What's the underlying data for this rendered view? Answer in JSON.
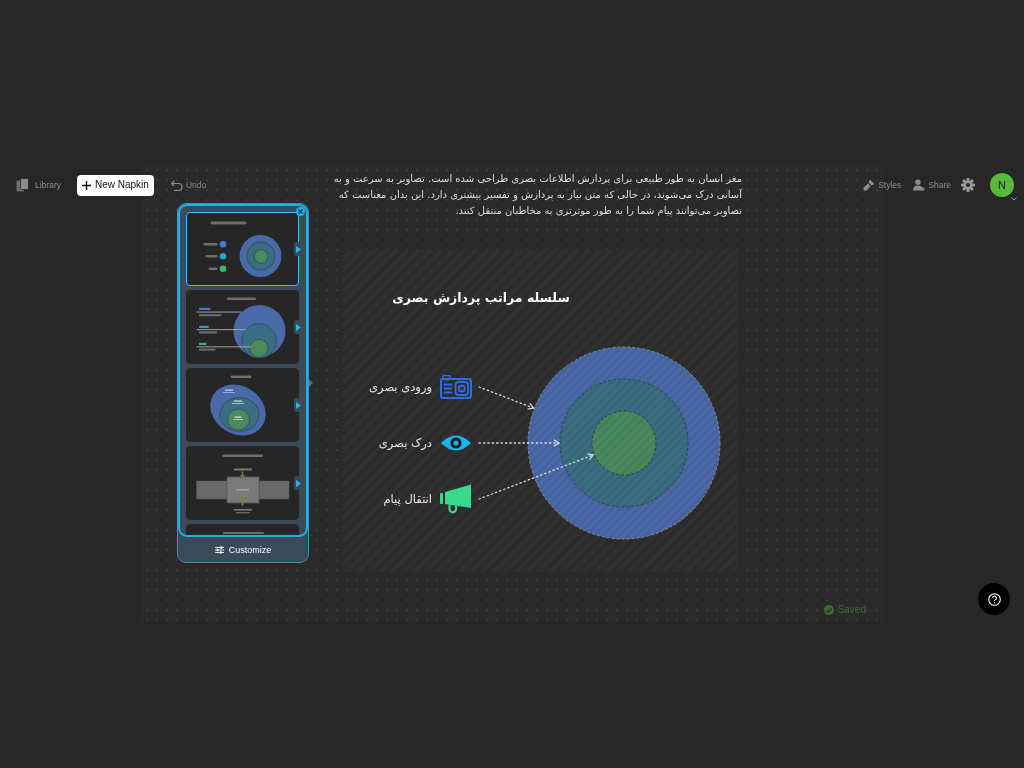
{
  "toolbar": {
    "library": "Library",
    "new_napkin": "New Napkin",
    "undo": "Undo",
    "styles": "Styles",
    "share": "Share",
    "avatar": "N"
  },
  "paragraph": "مغز انسان به طور طبیعی برای پردازش اطلاعات بصری طراحی شده است. تصاویر به سرعت و به آسانی درک می‌شوند، در حالی که متن نیاز به پردازش و تفسیر بیشتری دارد. این بدان معناست که تصاویر می‌توانند پیام شما را به طور موثرتری به مخاطبان منتقل کنند.",
  "style_panel": {
    "thumbnails": [
      {
        "kind": "circles",
        "selected": true
      },
      {
        "kind": "callouts",
        "selected": false
      },
      {
        "kind": "oval",
        "selected": false
      },
      {
        "kind": "pipe",
        "selected": false
      },
      {
        "kind": "clipped",
        "selected": false
      }
    ],
    "customize": "Customize"
  },
  "diagram": {
    "title": "سلسله مراتب پردازش بصری",
    "items": [
      {
        "label": "ورودی بصری",
        "kind": "camera",
        "color": "#2e6ee6"
      },
      {
        "label": "درک بصری",
        "kind": "eye",
        "color": "#1ab3ea"
      },
      {
        "label": "انتقال پیام",
        "kind": "megaphone",
        "color": "#3ad88a"
      }
    ]
  },
  "status": {
    "saved": "Saved"
  }
}
